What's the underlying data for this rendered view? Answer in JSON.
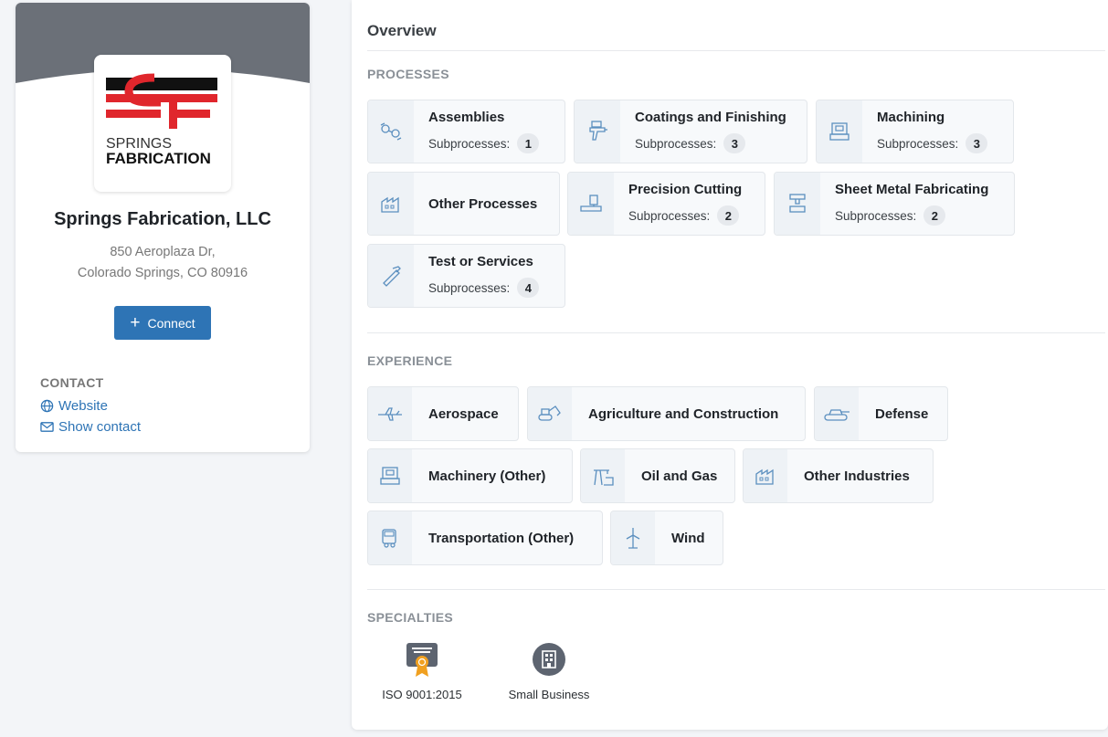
{
  "company": {
    "logo_top": "SF",
    "logo_line1": "SPRINGS",
    "logo_line2": "FABRICATION",
    "name": "Springs Fabrication, LLC",
    "address_line1": "850 Aeroplaza Dr,",
    "address_line2": "Colorado Springs, CO 80916",
    "connect_label": "Connect"
  },
  "contact": {
    "title": "CONTACT",
    "website_label": "Website",
    "show_contact_label": "Show contact"
  },
  "overview": {
    "title": "Overview",
    "processes_title": "PROCESSES",
    "subprocesses_label": "Subprocesses:",
    "processes": [
      {
        "name": "Assemblies",
        "count": "1",
        "icon": "assemblies-icon"
      },
      {
        "name": "Coatings and Finishing",
        "count": "3",
        "icon": "spray-gun-icon"
      },
      {
        "name": "Machining",
        "count": "3",
        "icon": "machining-icon"
      },
      {
        "name": "Other Processes",
        "count": null,
        "icon": "factory-icon"
      },
      {
        "name": "Precision Cutting",
        "count": "2",
        "icon": "cutting-icon"
      },
      {
        "name": "Sheet Metal Fabricating",
        "count": "2",
        "icon": "press-icon"
      },
      {
        "name": "Test or Services",
        "count": "4",
        "icon": "caliper-icon"
      }
    ],
    "experience_title": "EXPERIENCE",
    "experience": [
      {
        "name": "Aerospace",
        "icon": "airplane-icon"
      },
      {
        "name": "Agriculture and Construction",
        "icon": "excavator-icon"
      },
      {
        "name": "Defense",
        "icon": "tank-icon"
      },
      {
        "name": "Machinery (Other)",
        "icon": "machinery-icon"
      },
      {
        "name": "Oil and Gas",
        "icon": "oil-pump-icon"
      },
      {
        "name": "Other Industries",
        "icon": "factory-icon"
      },
      {
        "name": "Transportation (Other)",
        "icon": "truck-icon"
      },
      {
        "name": "Wind",
        "icon": "wind-turbine-icon"
      }
    ],
    "specialties_title": "SPECIALTIES",
    "specialties": [
      {
        "name": "ISO 9001:2015",
        "icon": "certificate-icon"
      },
      {
        "name": "Small Business",
        "icon": "building-icon"
      }
    ]
  },
  "colors": {
    "banner": "#6b7078",
    "accent": "#2e74b5",
    "logo_red": "#e0262c",
    "icon_blue": "#5b8fbf",
    "certificate_orange": "#f0a020"
  }
}
